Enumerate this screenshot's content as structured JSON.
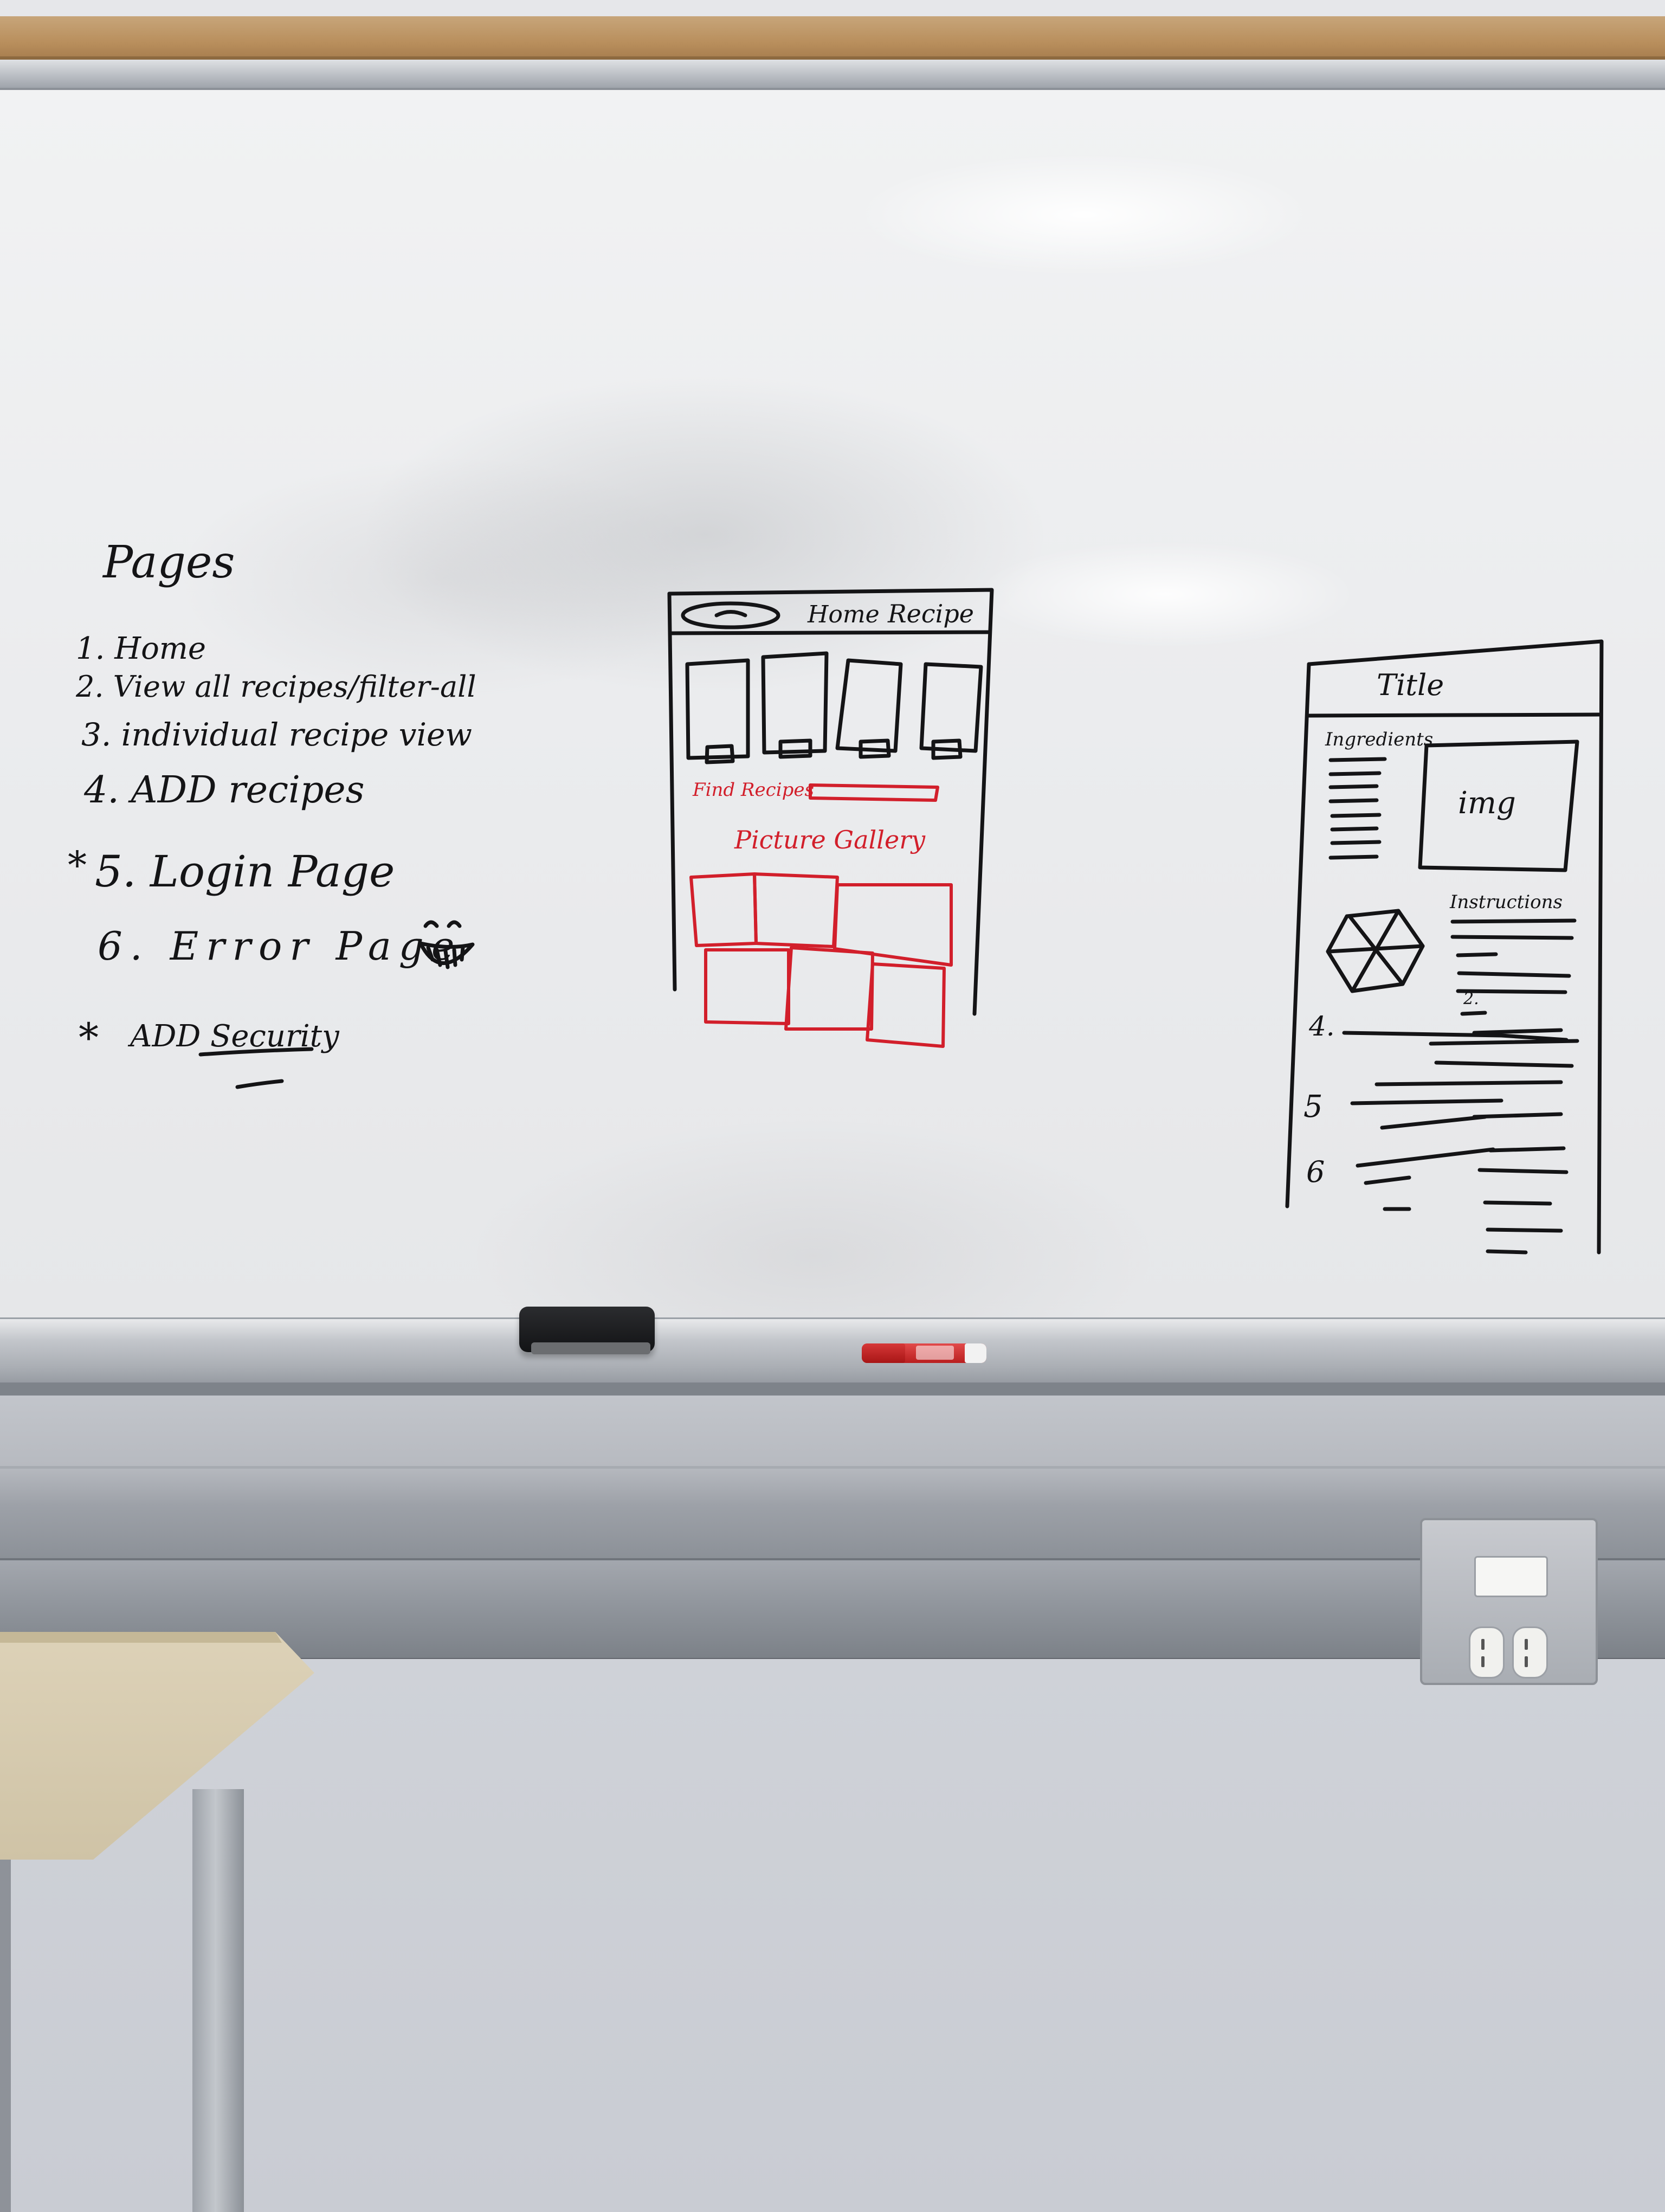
{
  "pages_list": {
    "heading": "Pages",
    "items": [
      "1. Home",
      "2. View all recipes/filter-all",
      "3. individual recipe view",
      "4. ADD recipes",
      "5. Login Page",
      "6. Error Page"
    ],
    "star_markers": [
      "*",
      "*"
    ],
    "security_note": "ADD Security"
  },
  "home_wireframe": {
    "nav_home": "Home",
    "nav_recipe": "Recipe",
    "find_recipes_label": "Find Recipes",
    "gallery_title": "Picture Gallery"
  },
  "recipe_wireframe": {
    "title": "Title",
    "ingredients_label": "Ingredients",
    "img_label": "img",
    "instructions_label": "Instructions",
    "step_numbers": [
      "2.",
      "4.",
      "5",
      "6"
    ]
  },
  "colors": {
    "ink_black": "#141416",
    "ink_red": "#d21f2b",
    "board": "#ebecee"
  },
  "icons": [
    "smiley-grin-icon",
    "pie-chart-sketch-icon"
  ]
}
